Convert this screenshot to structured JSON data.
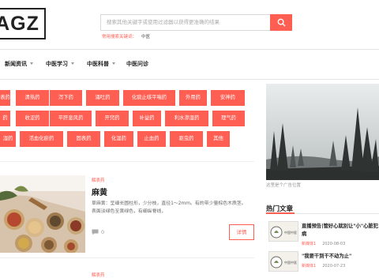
{
  "header": {
    "logo_text": "AGZ",
    "search_placeholder": "搜索其他关键字或使用过滤器以获得更准确的结果",
    "hot_label": "常用搜索关键词：",
    "hot_item": "中医"
  },
  "nav": {
    "items": [
      "新闻资讯",
      "中医学习",
      "中医科普",
      "中医问诊"
    ]
  },
  "tags": [
    [
      "表药",
      "清热药",
      "泻下药",
      "涌吐药",
      "化痰止咳平喘药",
      "外用药",
      "安神药"
    ],
    [
      "药",
      "收涩药",
      "平肝息风药",
      "开窍药",
      "补益药",
      "利水渗湿药",
      "理气药"
    ],
    [
      "湿药",
      "活血化瘀药",
      "固表药",
      "化湿药",
      "止血药",
      "驱虫药",
      "其他"
    ]
  ],
  "post": {
    "category": "解表药",
    "title": "麻黄",
    "excerpt": "草麻黄：呈细长圆柱形，少分枝，直径1～2mm。有的带少量棕色木质茎。表面淡绿色至黄绿色，有细纵脊线，",
    "comments": "0",
    "detail_label": "详情"
  },
  "post2": {
    "category": "解表药"
  },
  "sidebar": {
    "ad_caption": "这里是个广告位置",
    "hot_title": "热门文章",
    "articles": [
      {
        "title_line1": "直播预告|管好心就别让\"小\"心脏犯",
        "title_line2": "病",
        "author": "新媒体1",
        "date": "2020-08-03",
        "thumb_text": "中国中医"
      },
      {
        "title_line1": "\"我要干到干不动为止\"",
        "title_line2": "",
        "author": "新媒体1",
        "date": "2020-07-23",
        "thumb_text": "中国中医"
      }
    ]
  },
  "colors": {
    "accent": "#ff5e52"
  }
}
